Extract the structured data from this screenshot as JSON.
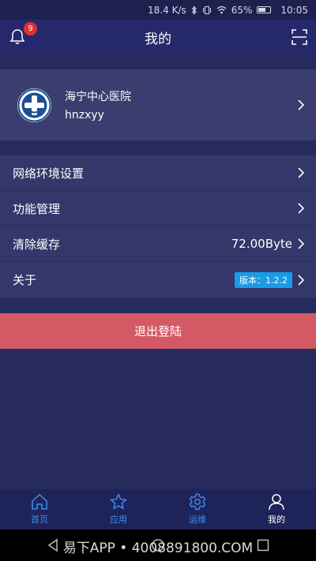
{
  "status_bar": {
    "speed": "18.4 K/s",
    "battery": "65%",
    "battery_level": 0.65,
    "time": "10:05"
  },
  "header": {
    "title": "我的",
    "notification_count": "9"
  },
  "profile": {
    "hospital_name": "海宁中心医院",
    "username": "hnzxyy"
  },
  "menu": {
    "items": [
      {
        "label": "网络环境设置"
      },
      {
        "label": "功能管理"
      },
      {
        "label": "清除缓存",
        "value": "72.00Byte"
      },
      {
        "label": "关于",
        "badge": "版本：1.2.2"
      }
    ]
  },
  "logout": {
    "label": "退出登陆"
  },
  "tabbar": {
    "tabs": [
      {
        "label": "首页",
        "icon": "home-icon"
      },
      {
        "label": "应用",
        "icon": "star-icon"
      },
      {
        "label": "运维",
        "icon": "gear-icon"
      },
      {
        "label": "我的",
        "icon": "person-icon"
      }
    ]
  },
  "watermark": "易下APP • 4008891800.COM",
  "colors": {
    "background": "#272a5c",
    "header": "#25286a",
    "logout": "#d35a64",
    "accent": "#3b8df0",
    "badge": "#e0312f",
    "version_badge": "#1a9be6"
  }
}
